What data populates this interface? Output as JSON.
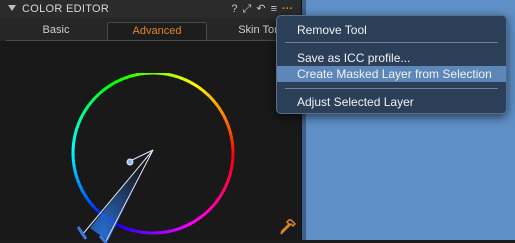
{
  "panel": {
    "title": "COLOR EDITOR",
    "header_icons": {
      "help": "?",
      "copy": "⤢",
      "reset": "↶",
      "menu": "≡",
      "more": "···"
    }
  },
  "tabs": [
    {
      "label": "Basic"
    },
    {
      "label": "Advanced"
    },
    {
      "label": "Skin Tor"
    }
  ],
  "active_tab": "Advanced",
  "menu": {
    "items": [
      {
        "label": "Remove Tool"
      },
      {
        "label": "Save as ICC profile..."
      },
      {
        "label": "Create Masked Layer from Selection"
      },
      {
        "label": "Adjust Selected Layer"
      }
    ],
    "selected": "Create Masked Layer from Selection"
  },
  "colors": {
    "accent": "#e0852a",
    "menu_bg": "#2b3f59",
    "menu_highlight": "#5c87b8",
    "canvas": "#5e8fc7"
  },
  "icons": {
    "collapse": "triangle-down-icon",
    "eyedropper": "eyedropper-icon"
  }
}
